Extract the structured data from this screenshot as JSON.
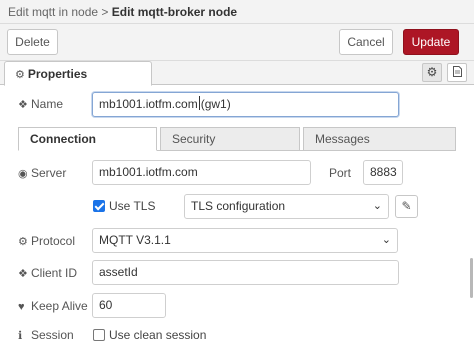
{
  "breadcrumb": {
    "parent": "Edit mqtt in node",
    "separator": ">",
    "current": "Edit mqtt-broker node"
  },
  "actions": {
    "delete": "Delete",
    "cancel": "Cancel",
    "update": "Update"
  },
  "colors": {
    "update_button": "#ad1625",
    "checkbox_checked": "#1a73e8",
    "focus_border": "#85a6d4"
  },
  "tabs": {
    "properties": {
      "icon": "gear-icon",
      "label": "Properties"
    },
    "tools": [
      {
        "icon": "gear-icon"
      },
      {
        "icon": "document-icon"
      }
    ]
  },
  "name": {
    "label": "Name",
    "icon": "tag-icon",
    "value_before_caret": "mb1001.iotfm.com",
    "value_after_caret": "(gw1)"
  },
  "subtabs": [
    {
      "label": "Connection",
      "active": true
    },
    {
      "label": "Security",
      "active": false
    },
    {
      "label": "Messages",
      "active": false
    }
  ],
  "server": {
    "label": "Server",
    "icon": "globe-icon",
    "value": "mb1001.iotfm.com",
    "port_label": "Port",
    "port_value": "8883"
  },
  "tls": {
    "checked": true,
    "label": "Use TLS",
    "config_value": "TLS configuration",
    "edit_icon": "pencil-icon"
  },
  "protocol": {
    "label": "Protocol",
    "icon": "gear-icon",
    "value": "MQTT V3.1.1"
  },
  "client_id": {
    "label": "Client ID",
    "icon": "tag-icon",
    "value": "assetId"
  },
  "keep_alive": {
    "label": "Keep Alive",
    "icon": "heartbeat-icon",
    "value": "60"
  },
  "session": {
    "label": "Session",
    "icon": "info-icon",
    "checked": false,
    "option": "Use clean session"
  }
}
